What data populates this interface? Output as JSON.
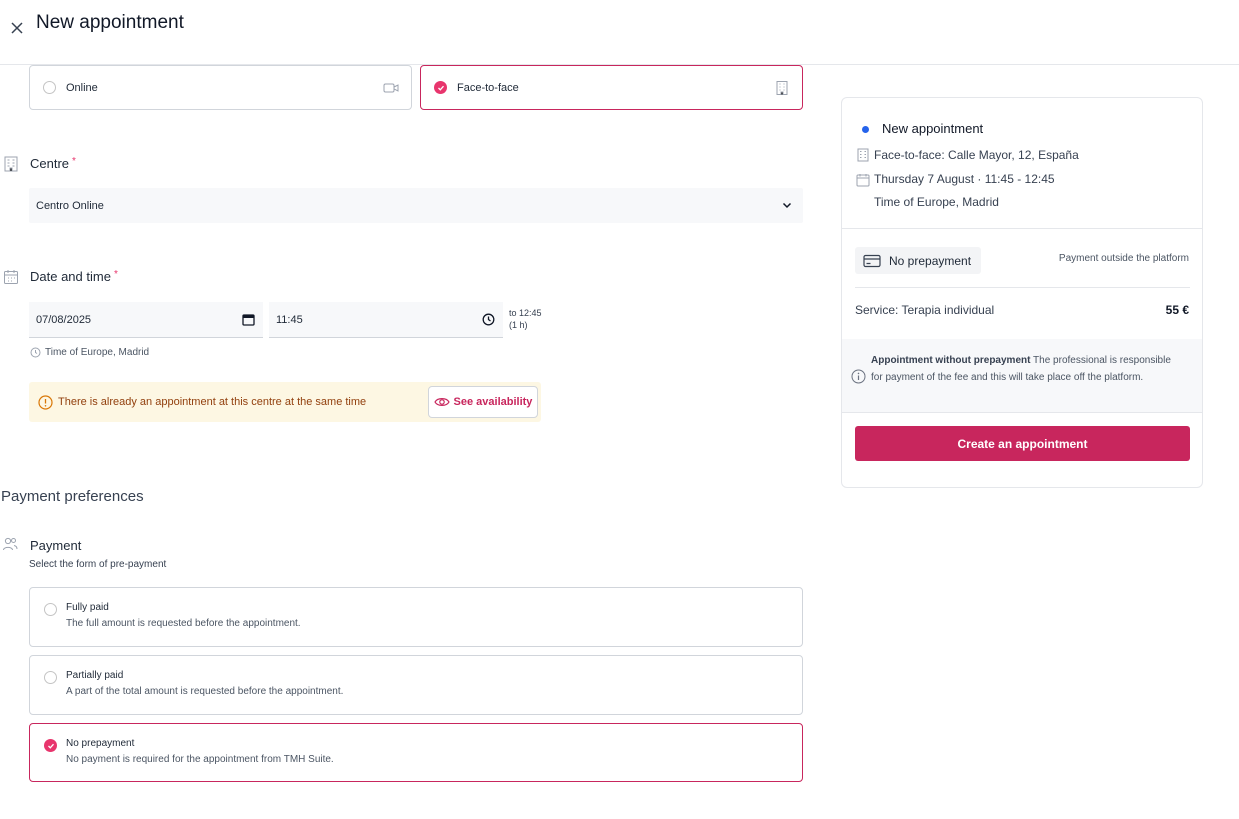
{
  "header": {
    "title": "New appointment",
    "close_icon": "close-icon"
  },
  "mode": {
    "online_label": "Online",
    "face_label": "Face-to-face",
    "selected": "Face-to-face"
  },
  "centre": {
    "label": "Centre",
    "required": "*",
    "value": "Centro Online"
  },
  "datetime": {
    "label": "Date and time",
    "required": "*",
    "date": "07/08/2025",
    "time": "11:45",
    "to_line1": "to 12:45",
    "to_line2": "(1 h)",
    "timezone": "Time of Europe, Madrid"
  },
  "warning": {
    "text": "There is already an appointment at this centre at the same time",
    "button": "See availability"
  },
  "payment": {
    "heading": "Payment preferences",
    "label": "Payment",
    "sub": "Select the form of pre-payment",
    "options": [
      {
        "title": "Fully paid",
        "desc": "The full amount is requested before the appointment."
      },
      {
        "title": "Partially paid",
        "desc": "A part of the total amount is requested before the appointment."
      },
      {
        "title": "No prepayment",
        "desc": "No payment is required for the appointment from TMH Suite."
      }
    ],
    "selected": "No prepayment"
  },
  "summary": {
    "title": "New appointment",
    "location": "Face-to-face: Calle Mayor, 12, España",
    "date": "Thursday 7 August · 11:45 - 12:45",
    "timezone": "Time of Europe, Madrid",
    "badge": "No prepayment",
    "payment_note": "Payment outside the platform",
    "service": "Service: Terapia individual",
    "price": "55 €",
    "info_bold": "Appointment without prepayment",
    "info_text": " The professional is responsible for payment of the fee and this will take place off the platform.",
    "create_button": "Create an appointment"
  },
  "colors": {
    "accent": "#c8265d",
    "radio": "#e8356d",
    "dot": "#2563eb",
    "warning_bg": "#fdf7e3"
  }
}
